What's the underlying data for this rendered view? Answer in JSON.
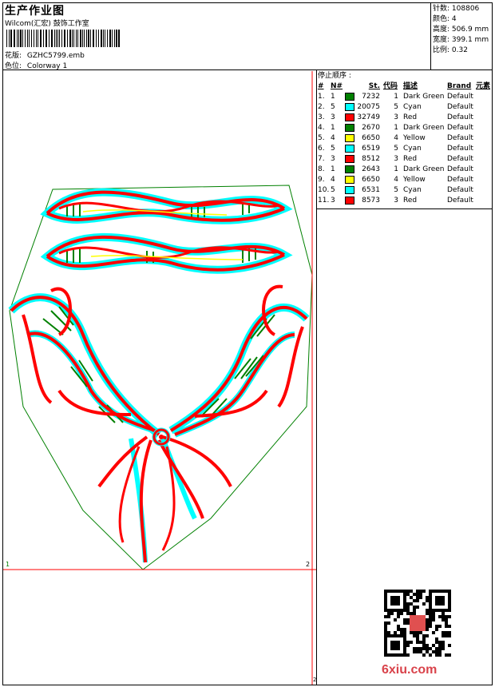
{
  "header": {
    "title": "生产作业图",
    "company": "Wilcom(汇宏) 鼓饰工作室",
    "design_label": "花版:",
    "design_file": "GZHC5799.emb",
    "colorway_label": "色位:",
    "colorway": "Colorway 1"
  },
  "stats": {
    "stitches_label": "针数:",
    "stitches": "108806",
    "colors_label": "颜色:",
    "colors": "4",
    "height_label": "高度:",
    "height": "506.9 mm",
    "width_label": "宽度:",
    "width": "399.1 mm",
    "scale_label": "比例:",
    "scale": "0.32"
  },
  "stop_sequence": {
    "title": "停止顺序 :",
    "headers": [
      "#",
      "N#",
      "St.",
      "代码",
      "描述",
      "Brand",
      "元素"
    ],
    "rows": [
      {
        "idx": "1.",
        "n": "1",
        "color": "#008000",
        "st": "7232",
        "code": "1",
        "desc": "Dark Green",
        "brand": "Default"
      },
      {
        "idx": "2.",
        "n": "5",
        "color": "#00ffff",
        "st": "20075",
        "code": "5",
        "desc": "Cyan",
        "brand": "Default"
      },
      {
        "idx": "3.",
        "n": "3",
        "color": "#ff0000",
        "st": "32749",
        "code": "3",
        "desc": "Red",
        "brand": "Default"
      },
      {
        "idx": "4.",
        "n": "1",
        "color": "#008000",
        "st": "2670",
        "code": "1",
        "desc": "Dark Green",
        "brand": "Default"
      },
      {
        "idx": "5.",
        "n": "4",
        "color": "#ffff00",
        "st": "6650",
        "code": "4",
        "desc": "Yellow",
        "brand": "Default"
      },
      {
        "idx": "6.",
        "n": "5",
        "color": "#00ffff",
        "st": "6519",
        "code": "5",
        "desc": "Cyan",
        "brand": "Default"
      },
      {
        "idx": "7.",
        "n": "3",
        "color": "#ff0000",
        "st": "8512",
        "code": "3",
        "desc": "Red",
        "brand": "Default"
      },
      {
        "idx": "8.",
        "n": "1",
        "color": "#008000",
        "st": "2643",
        "code": "1",
        "desc": "Dark Green",
        "brand": "Default"
      },
      {
        "idx": "9.",
        "n": "4",
        "color": "#ffff00",
        "st": "6650",
        "code": "4",
        "desc": "Yellow",
        "brand": "Default"
      },
      {
        "idx": "10.",
        "n": "5",
        "color": "#00ffff",
        "st": "6531",
        "code": "5",
        "desc": "Cyan",
        "brand": "Default"
      },
      {
        "idx": "11.",
        "n": "3",
        "color": "#ff0000",
        "st": "8573",
        "code": "3",
        "desc": "Red",
        "brand": "Default"
      }
    ]
  },
  "canvas": {
    "marker_1": "1",
    "marker_2": "2",
    "marker_3": "2"
  },
  "watermark": "6xiu.com",
  "colors": {
    "red": "#ff0000",
    "cyan": "#00ffff",
    "green": "#008000",
    "yellow": "#ffff00",
    "outline_green": "#008000"
  }
}
